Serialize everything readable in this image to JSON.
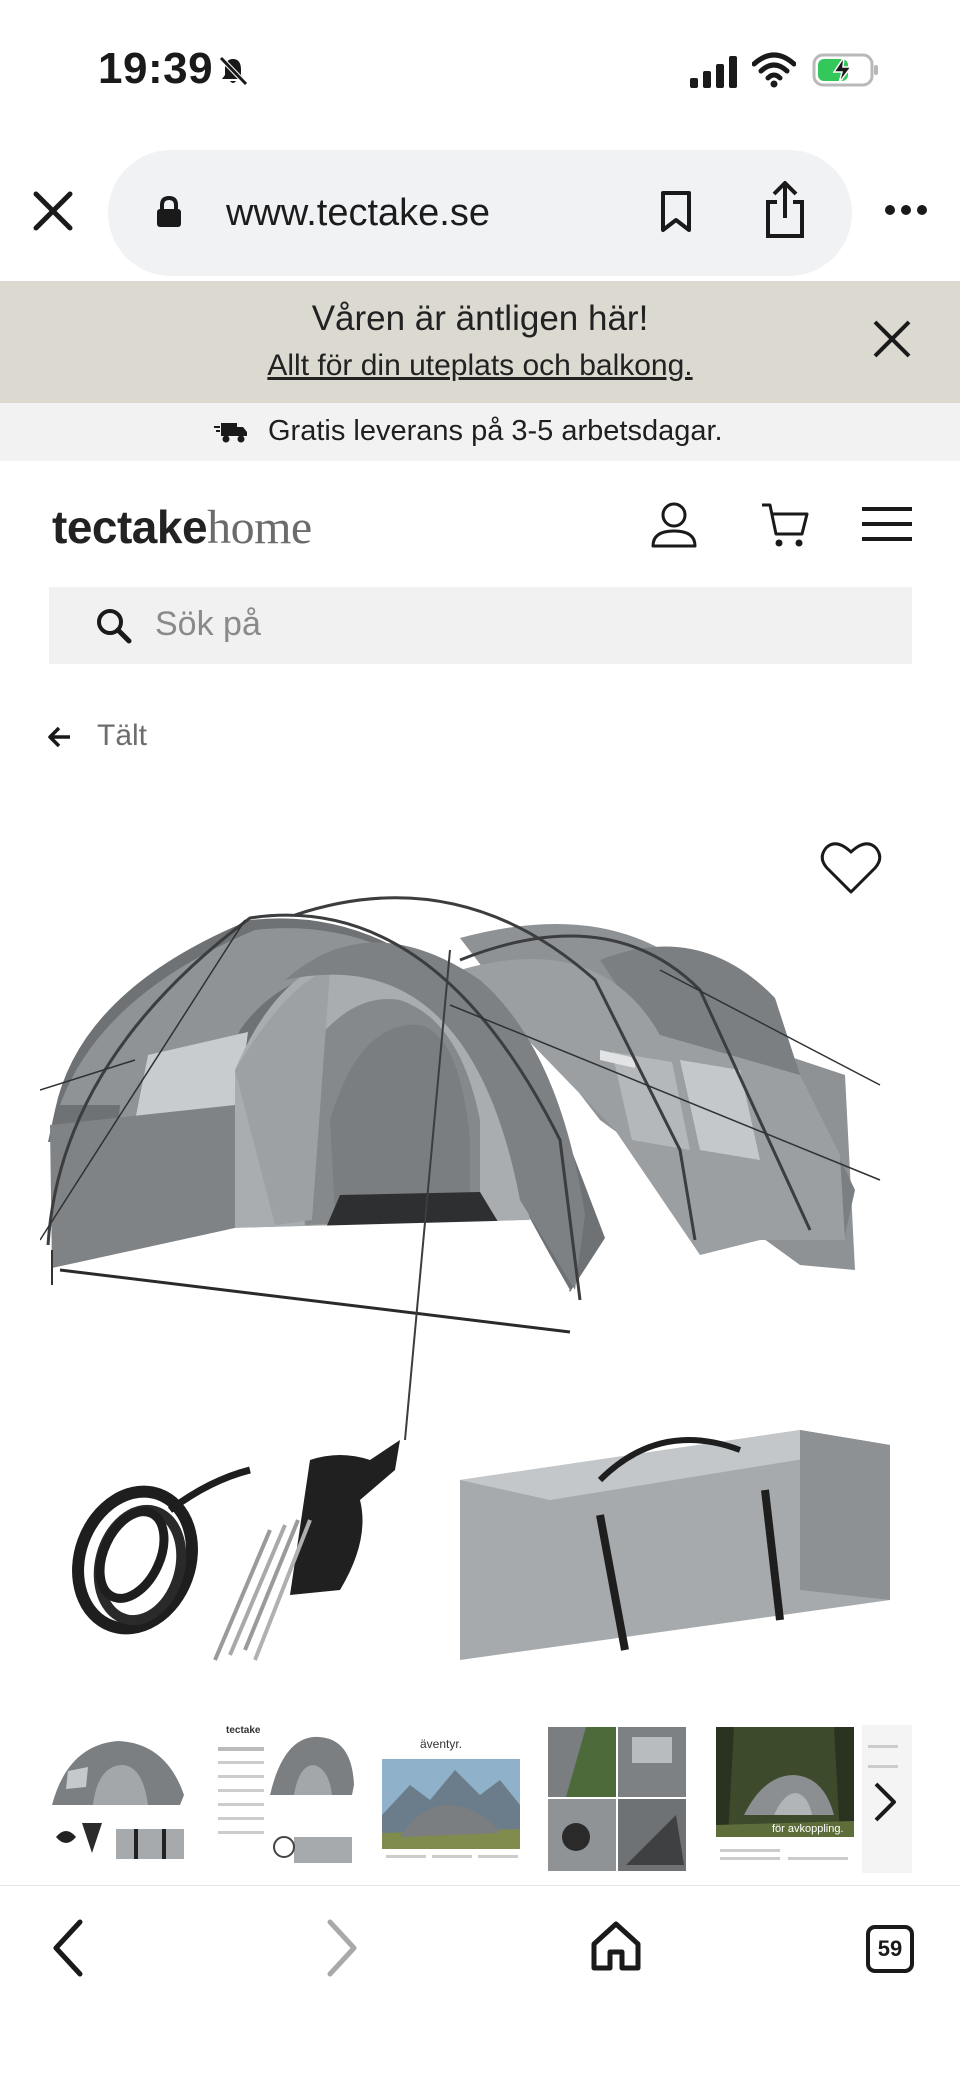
{
  "status_bar": {
    "time": "19:39"
  },
  "browser": {
    "url": "www.tectake.se",
    "tab_count": "59"
  },
  "promo": {
    "title": "Våren är äntligen här!",
    "link": "Allt för din uteplats och balkong."
  },
  "shipping": {
    "text": "Gratis leverans på 3-5 arbetsdagar."
  },
  "header": {
    "logo_bold": "tectake",
    "logo_light": "home"
  },
  "search": {
    "placeholder": "Sök på"
  },
  "breadcrumb": {
    "label": "Tält"
  },
  "product": {
    "thumbnails": [
      {
        "name": "thumb-tent-set"
      },
      {
        "name": "thumb-infographic",
        "caption": "tectake"
      },
      {
        "name": "thumb-adventure",
        "caption": "äventyr."
      },
      {
        "name": "thumb-details"
      },
      {
        "name": "thumb-forest",
        "caption": "för avkoppling."
      }
    ]
  },
  "colors": {
    "promo_bg": "#dcd9d1",
    "tent_dark": "#6e7275",
    "tent_light": "#a7abad",
    "url_pill": "#f1f2f4"
  },
  "icons": [
    "bell-slash-icon",
    "signal-icon",
    "wifi-icon",
    "battery-charging-icon",
    "close-icon",
    "lock-icon",
    "bookmark-icon",
    "share-icon",
    "more-icon",
    "delivery-truck-icon",
    "user-icon",
    "cart-icon",
    "menu-icon",
    "search-icon",
    "arrow-left-icon",
    "heart-icon",
    "chevron-right-icon",
    "back-icon",
    "forward-icon",
    "home-icon"
  ]
}
